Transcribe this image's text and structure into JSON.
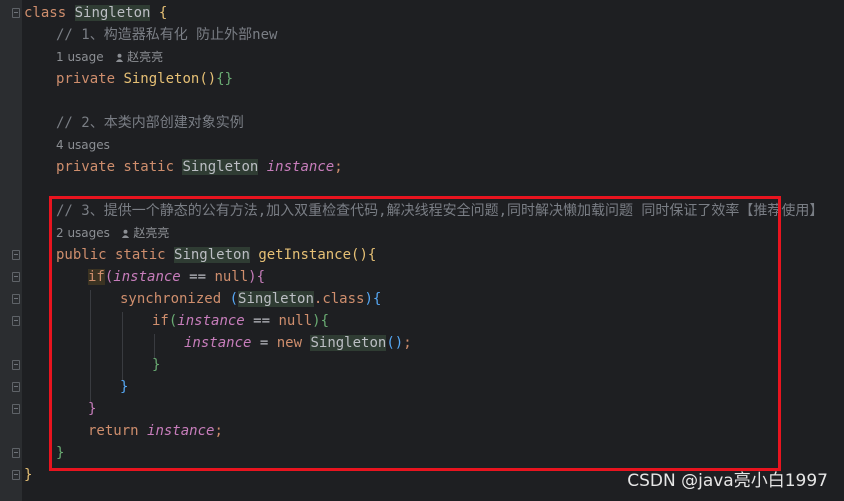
{
  "code": {
    "class_kw": "class",
    "class_name": "Singleton",
    "open_brace": "{",
    "close_brace": "}",
    "comment1": "// 1、构造器私有化 防止外部new",
    "usage1_count": "1 usage",
    "usage1_author": "赵亮亮",
    "ctor_kw": "private",
    "ctor_name": "Singleton",
    "ctor_parens": "()",
    "ctor_body": "{}",
    "comment2": "// 2、本类内部创建对象实例",
    "usage2_count": "4 usages",
    "field_kw": "private static",
    "field_type": "Singleton",
    "field_name": "instance",
    "semicolon": ";",
    "comment3": "// 3、提供一个静态的公有方法,加入双重检查代码,解决线程安全问题,同时解决懒加载问题 同时保证了效率【推荐使用】",
    "usage3_count": "2 usages",
    "usage3_author": "赵亮亮",
    "method_kw": "public static",
    "method_type": "Singleton",
    "method_name": "getInstance",
    "if_kw": "if",
    "paren_open": "(",
    "paren_close": ")",
    "instance": "instance",
    "eq_null": " == ",
    "null_kw": "null",
    "sync_kw": "synchronized",
    "sync_class": "Singleton",
    "dot_class": ".class",
    "assign": " = ",
    "new_kw": "new",
    "new_type": "Singleton",
    "new_parens": "()",
    "return_kw": "return"
  },
  "watermark": "CSDN @java亮小白1997"
}
